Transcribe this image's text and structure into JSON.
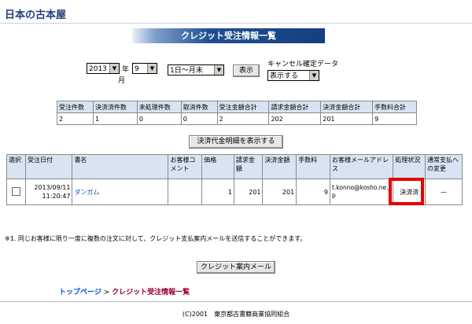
{
  "logo": "日本の古本屋",
  "banner_title": "クレジット受注情報一覧",
  "filters": {
    "year_value": "2013",
    "year_suffix": "年",
    "month_value": "9",
    "month_suffix": "月",
    "period_value": "1日～月末",
    "show_button": "表示",
    "cancel_label": "キャンセル確定データ",
    "cancel_value": "表示する"
  },
  "summary": {
    "headers": [
      "受注件数",
      "決済済件数",
      "未処理件数",
      "取消件数",
      "受注金額合計",
      "請求金額合計",
      "決済金額合計",
      "手数料合計"
    ],
    "values": [
      "2",
      "1",
      "0",
      "0",
      "2",
      "202",
      "201",
      "9"
    ]
  },
  "detail_button": "決済代金明細を表示する",
  "orders": {
    "headers": [
      "選択",
      "受注日付",
      "書名",
      "お客様コメント",
      "価格",
      "請求金額",
      "決済金額",
      "手数料",
      "お客様メールアドレス",
      "処理状況",
      "通常支払への変更"
    ],
    "rows": [
      {
        "date": "2013/09/11",
        "time": "11:20:47",
        "title": "ダンガム",
        "comment": "",
        "price": "1",
        "billing": "201",
        "settled": "201",
        "fee": "9",
        "email": "t.konno@kosho.ne.jp",
        "status": "決済済",
        "change": "—"
      }
    ]
  },
  "note": "※1. 同じお客様に限り一度に複数の注文に対して、クレジット支払案内メールを送信することができます。",
  "mail_button": "クレジット案内メール",
  "breadcrumb": {
    "home": "トップページ",
    "sep": ">",
    "current": "クレジット受注情報一覧"
  },
  "footer": "(C)2001　東京都古書籍商業協同組合",
  "colors": {
    "header_bg": "#d8e4f2",
    "banner": "#1f4f93",
    "highlight": "#e60000",
    "link": "#0055cc"
  }
}
